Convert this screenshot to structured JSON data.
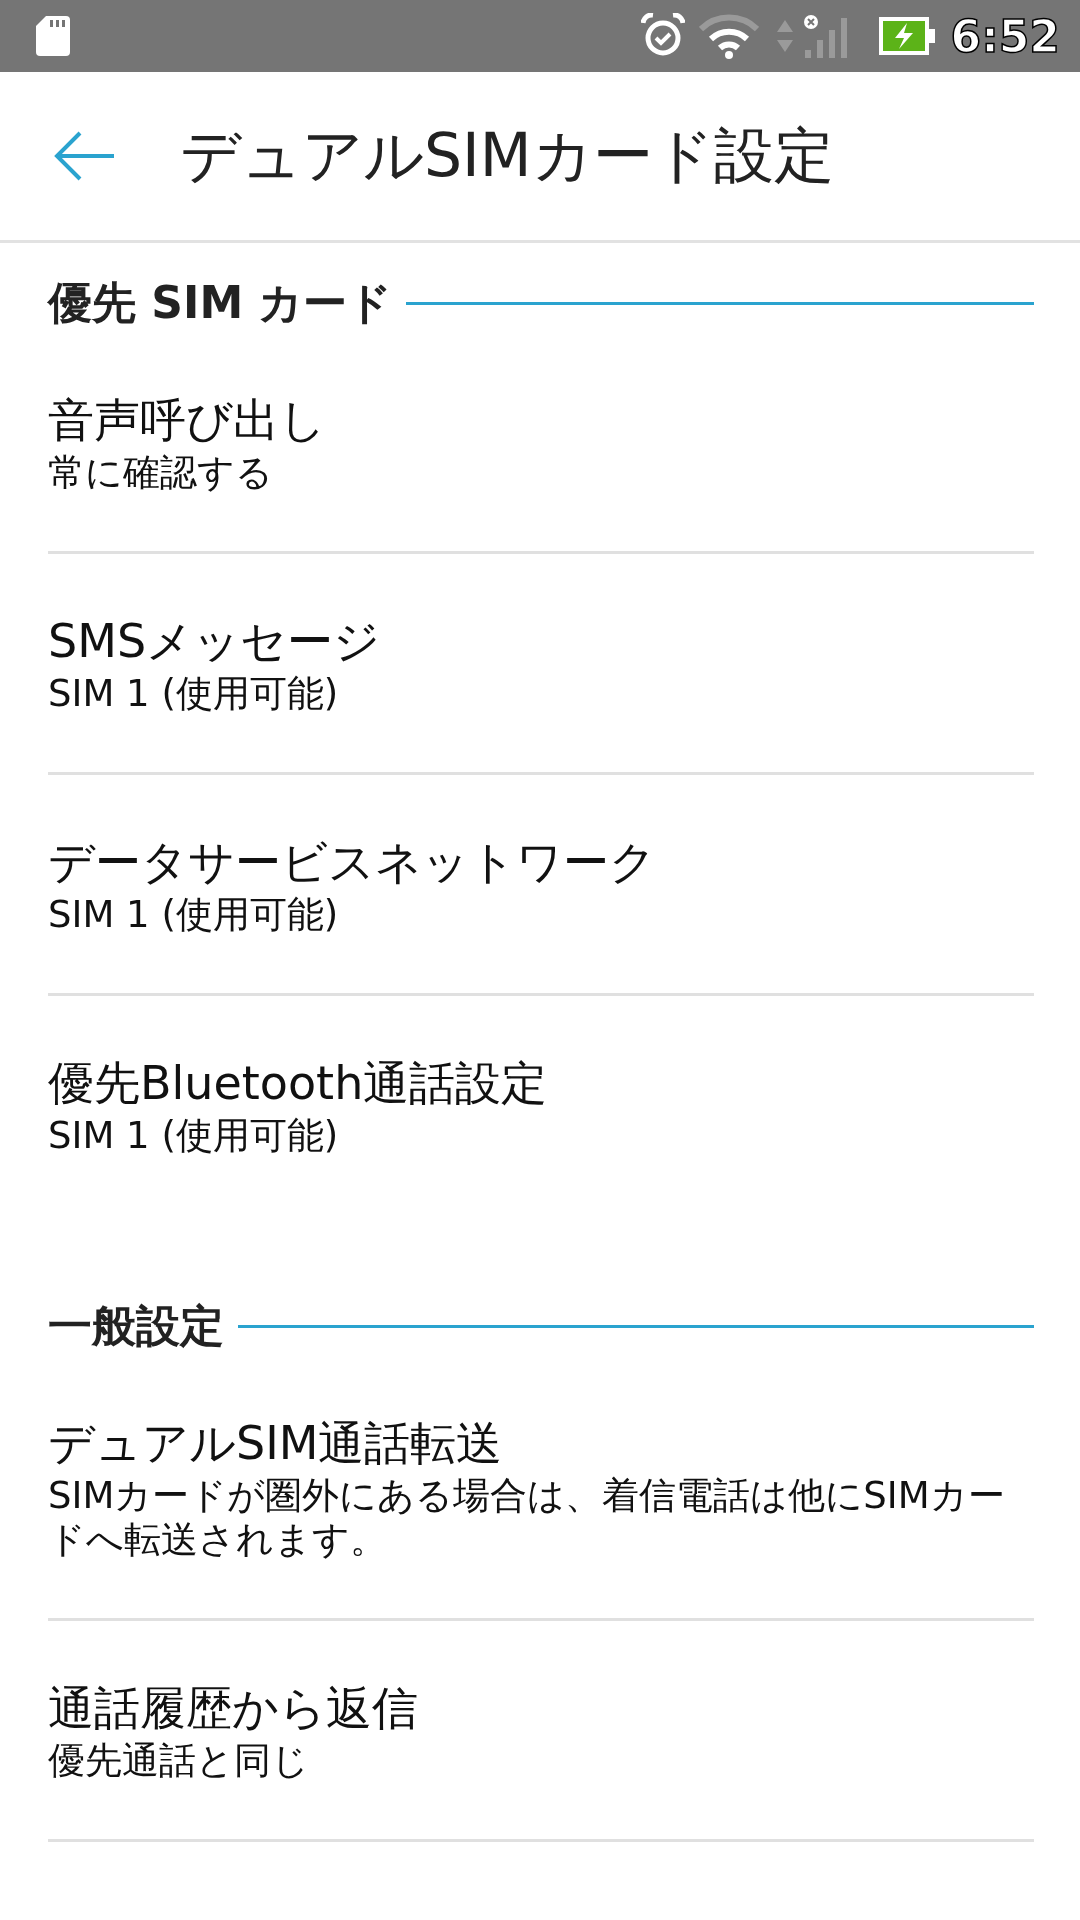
{
  "status_bar": {
    "time": "6:52"
  },
  "header": {
    "title": "デュアルSIMカード設定"
  },
  "sections": [
    {
      "title": "優先 SIM カード",
      "items": [
        {
          "title": "音声呼び出し",
          "summary": "常に確認する"
        },
        {
          "title": "SMSメッセージ",
          "summary": "SIM 1 (使用可能)"
        },
        {
          "title": "データサービスネットワーク",
          "summary": "SIM 1 (使用可能)"
        },
        {
          "title": "優先Bluetooth通話設定",
          "summary": "SIM 1 (使用可能)"
        }
      ]
    },
    {
      "title": "一般設定",
      "items": [
        {
          "title": "デュアルSIM通話転送",
          "summary": "SIMカードが圏外にある場合は、着信電話は他にSIMカードへ転送されます。"
        },
        {
          "title": "通話履歴から返信",
          "summary": "優先通話と同じ"
        }
      ]
    }
  ]
}
